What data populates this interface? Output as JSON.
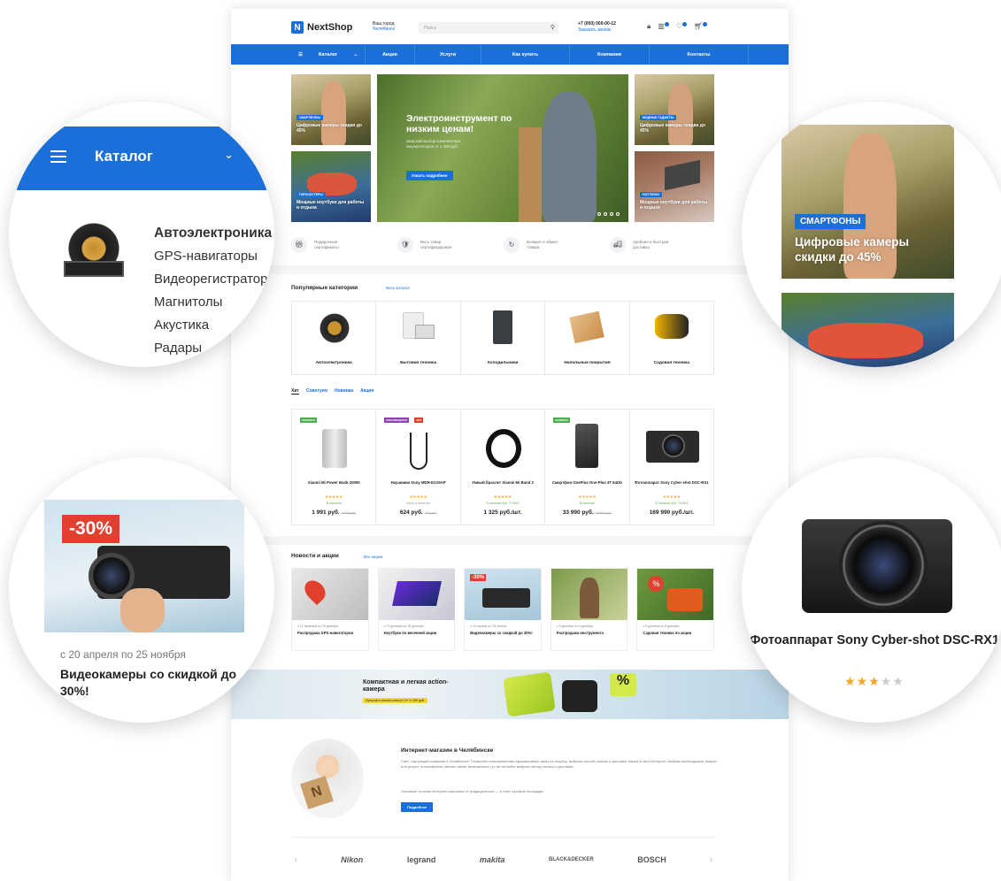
{
  "header": {
    "logo": "NextShop",
    "city_label": "Ваш город",
    "city_value": "Челябинск",
    "search_placeholder": "Поиск",
    "phone": "+7 (000) 000-00-12",
    "callback": "Заказать звонок"
  },
  "nav": [
    "Каталог",
    "Акции",
    "Услуги",
    "Как купить",
    "Компания",
    "Контакты"
  ],
  "banners": {
    "left_top": {
      "tag": "СМАРТФОНЫ",
      "text": "Цифровые камеры скидки до 45%"
    },
    "left_bottom": {
      "tag": "ГИРОСКУТЕРЫ",
      "text": "Мощные ноутбуки для работы и отдыха"
    },
    "main": {
      "title": "Электроинструмент по низким ценам!",
      "subtitle": "Широкий выбор комплектных аккумуляторов от 1 399 руб.",
      "button": "Узнать подробнее"
    },
    "right_top": {
      "tag": "МОДНЫЕ ГАДЖЕТЫ",
      "text": "Цифровые камеры скидки до 45%"
    },
    "right_bottom": {
      "tag": "НОУТБУКИ",
      "text": "Мощные ноутбуки для работы и отдыха"
    }
  },
  "features": [
    {
      "icon": "gift-icon",
      "text": "Подарочные сертификаты"
    },
    {
      "icon": "shield-check-icon",
      "text": "Весь товар сертифицирован"
    },
    {
      "icon": "return-box-icon",
      "text": "Возврат и обмен товара"
    },
    {
      "icon": "truck-icon",
      "text": "Удобная и быстрая доставка"
    }
  ],
  "categories": {
    "title": "Популярные категории",
    "link": "Весь каталог",
    "items": [
      "Автоэлектроника",
      "Бытовая техника",
      "Холодильники",
      "Напольные покрытия",
      "Садовая техника"
    ]
  },
  "tabs": [
    "Хит",
    "Советуем",
    "Новинка",
    "Акция"
  ],
  "products": [
    {
      "badge": "НОВИНКА",
      "name": "Xiaomi Mi Power Bank 20000",
      "avail": "В наличии",
      "price": "1 991 руб.",
      "old": "2 490 руб."
    },
    {
      "badge": "РЕКОМЕНДУЕМ",
      "badge2": "ХИТ",
      "name": "Наушники Sony MDR-EX15AP",
      "avail": "Мало в наличии",
      "price": "624 руб.",
      "old": "780 руб."
    },
    {
      "badge": "",
      "name": "Умный браслет Xiaomi Mi Band 2",
      "avail": "В наличии  Арт. 712543",
      "price": "1 325 руб./шт.",
      "old": ""
    },
    {
      "badge": "НОВИНКА",
      "name": "Смартфон OnePlus One-Plus 3T 64Gb",
      "avail": "В наличии",
      "price": "33 990 руб.",
      "old": "40 990 руб."
    },
    {
      "badge": "",
      "name": "Фотоаппарат Sony Cyber-shot DSC-RX1",
      "avail": "В наличии  Арт. 712543",
      "price": "169 990 руб./шт.",
      "old": ""
    }
  ],
  "news": {
    "title": "Новости и акции",
    "link": "Все акции",
    "items": [
      {
        "date": "с 12 февраля по 20 декабря",
        "title": "Распродажа GPS-навигаторов"
      },
      {
        "date": "с 01 декабря по 30 декабря",
        "title": "Ноутбуки по весенней акции"
      },
      {
        "date": "с 20 апреля по 25 ноября",
        "title": "Видеокамеры со скидкой до 30%!"
      },
      {
        "date": "с 5 декабря по 6 декабря",
        "title": "Распродажа инструмента"
      },
      {
        "date": "с 5 декабря по 6 декабря",
        "title": "Садовая техника по акции"
      }
    ]
  },
  "promo": {
    "title": "Компактная и легкая action-камера",
    "badge": "Лучшая в своем классе! От 3 499 руб."
  },
  "about": {
    "title": "Интернет-магазин в Челябинске",
    "p1": "Сайт, торгующий товарами в Челябинске. Позволяет пользователям сформировать заказ на покупку, выбрать способ оплаты и доставки заказа в сети Интернет. Выбрав необходимые товары или услуги, пользователь обычно имеет возможность тут же на сайте выбрать метод оплаты и доставки.",
    "p2": "Основное отличие Интернет-магазина от традиционного — в типе торговой площадки.",
    "button": "Подробнее"
  },
  "brands": [
    "Nikon",
    "legrand",
    "makita",
    "BLACK&DECKER",
    "BOSCH"
  ],
  "zoom_catalog": {
    "title": "Каталог",
    "heading": "Автоэлектроника",
    "items": [
      "GPS-навигаторы",
      "Видеорегистраторы",
      "Магнитолы",
      "Акустика",
      "Радары"
    ]
  },
  "zoom_banner": {
    "tag": "СМАРТФОНЫ",
    "text": "Цифровые камеры скидки до 45%"
  },
  "zoom_sale": {
    "badge": "-30%",
    "date": "с 20 апреля по 25 ноября",
    "title": "Видеокамеры со скидкой до 30%!"
  },
  "zoom_product": {
    "name": "Фотоаппарат Sony Cyber-shot DSC-RX1",
    "rating": 3,
    "max_rating": 5
  },
  "colors": {
    "accent": "#1b6fd8",
    "sale": "#e2402f",
    "star": "#f5a623"
  }
}
